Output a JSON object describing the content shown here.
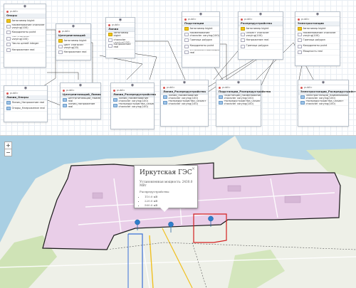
{
  "erd": {
    "tables": [
      {
        "id": "t1",
        "schema": "public",
        "name": "Опоры",
        "cols": [
          {
            "label": "Автономер bigint",
            "icon": "pk"
          },
          {
            "label": "Наименование character varying(100)",
            "icon": "col"
          },
          {
            "label": "Координаты point",
            "icon": "col"
          },
          {
            "label": "Тип character varying(100)",
            "icon": "col"
          },
          {
            "label": "Число цепей integer",
            "icon": "col"
          },
          {
            "label": "Напряжение real",
            "icon": "col"
          }
        ]
      },
      {
        "id": "t2",
        "schema": "public",
        "name": "Центрпитающий",
        "cols": [
          {
            "label": "Автономер bigint",
            "icon": "pk"
          },
          {
            "label": "Цвет character varying(20)",
            "icon": "col"
          },
          {
            "label": "Напряжение real",
            "icon": "col"
          }
        ]
      },
      {
        "id": "t3",
        "schema": "public",
        "name": "Линии",
        "cols": [
          {
            "label": "Автономер bigint",
            "icon": "pk"
          },
          {
            "label": "Наименование character varying(100)",
            "icon": "col"
          },
          {
            "label": "Напряжение real",
            "icon": "col"
          }
        ]
      },
      {
        "id": "t4",
        "schema": "public",
        "name": "Подстанции",
        "cols": [
          {
            "label": "Автономер bigint",
            "icon": "pk"
          },
          {
            "label": "Наименование character varying(100)",
            "icon": "col"
          },
          {
            "label": "Граница polygon",
            "icon": "col"
          },
          {
            "label": "Координаты point",
            "icon": "col"
          },
          {
            "label": "УстановленнаяМощность real",
            "icon": "col"
          }
        ]
      },
      {
        "id": "t5",
        "schema": "public",
        "name": "Распредустройства",
        "cols": [
          {
            "label": "Автономер bigint",
            "icon": "pk"
          },
          {
            "label": "Объект character varying(100)",
            "icon": "col"
          },
          {
            "label": "Напряжение real",
            "icon": "col"
          },
          {
            "label": "Граница polygon",
            "icon": "col"
          }
        ]
      },
      {
        "id": "t6",
        "schema": "public",
        "name": "Электростанции",
        "cols": [
          {
            "label": "Автономер bigint",
            "icon": "pk"
          },
          {
            "label": "Наименование character varying(100)",
            "icon": "col"
          },
          {
            "label": "Граница polygon",
            "icon": "col"
          },
          {
            "label": "Координаты point",
            "icon": "col"
          },
          {
            "label": "Мощность real",
            "icon": "col"
          }
        ]
      },
      {
        "id": "t7",
        "schema": "public",
        "name": "Линии_Опоры",
        "cols": [
          {
            "label": "Линии_Напряжение real",
            "icon": "fk"
          },
          {
            "label": "Опоры_Напряжение real",
            "icon": "fk"
          }
        ]
      },
      {
        "id": "t8",
        "schema": "public",
        "name": "Центрпитающий_Линия",
        "cols": [
          {
            "label": "Центрпитающий_Наименование real",
            "icon": "fk"
          },
          {
            "label": "Линии_Напряжение real",
            "icon": "fk"
          }
        ]
      },
      {
        "id": "t9",
        "schema": "public",
        "name": "Линии_Распредустройства",
        "cols": [
          {
            "label": "Линии_Наименование character varying(100)",
            "icon": "fk"
          },
          {
            "label": "Распредустройства_Объект character varying(100)",
            "icon": "fk"
          }
        ]
      },
      {
        "id": "t10",
        "schema": "public",
        "name": "Линии_Распредустройства",
        "cols": [
          {
            "label": "Линии_Наименование character varying(100)",
            "icon": "fk"
          },
          {
            "label": "Распредустройства_Объект character varying(100)",
            "icon": "fk"
          }
        ]
      },
      {
        "id": "t11",
        "schema": "public",
        "name": "Подстанции_Распредустройства",
        "cols": [
          {
            "label": "Подстанции_Наименование character varying(100)",
            "icon": "fk"
          },
          {
            "label": "Распредустройства_Объект character varying(100)",
            "icon": "fk"
          }
        ]
      },
      {
        "id": "t12",
        "schema": "public",
        "name": "Электростанции_Распредустройства",
        "cols": [
          {
            "label": "Электростанции_Наименование character varying(100)",
            "icon": "fk"
          },
          {
            "label": "Распредустройства_Объект character varying(100)",
            "icon": "fk"
          }
        ]
      }
    ]
  },
  "map": {
    "zoom_in": "+",
    "zoom_out": "−",
    "popup": {
      "title": "Иркутская ГЭС",
      "power_line": "Установленная мощность: 2430.0 MВт",
      "devices_label": "Распредустройства:",
      "devices": [
        "110.0 кВ",
        "220.0 кВ",
        "500.0 кВ"
      ],
      "close": "×"
    },
    "colors": {
      "plant_fill": "#e8c8e8",
      "boundary": "#1a1a1a",
      "red_line": "#d42020",
      "blue_line": "#3a6fd8",
      "yellow_line": "#f0c020",
      "water": "#a9cfe3",
      "marker": "#2f7ecb"
    }
  }
}
